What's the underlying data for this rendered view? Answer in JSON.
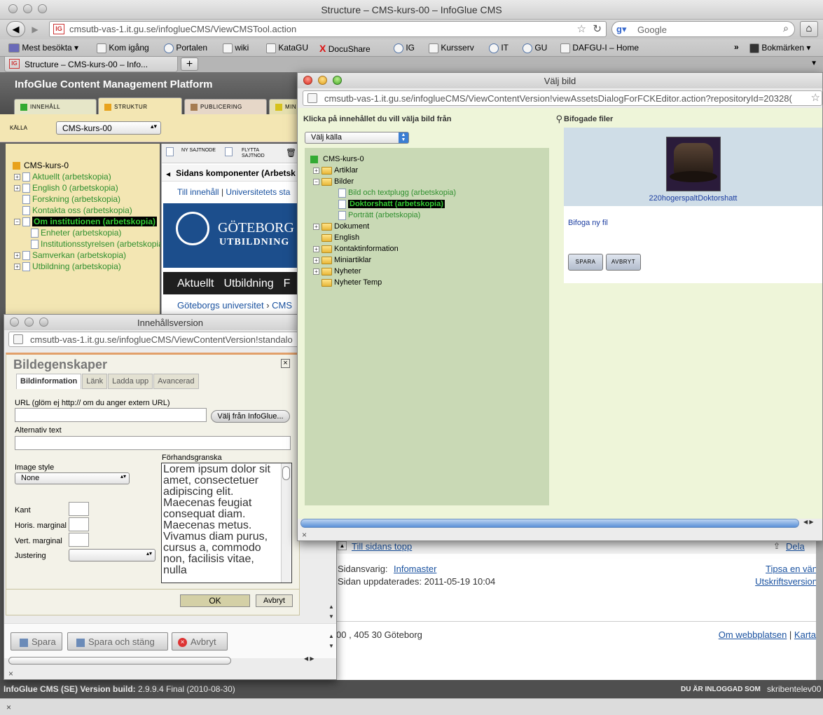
{
  "browser": {
    "window_title": "Structure – CMS-kurs-00 – InfoGlue CMS",
    "url": "cmsutb-vas-1.it.gu.se/infoglueCMS/ViewCMSTool.action",
    "search_placeholder": "Google",
    "bookmarks": [
      "Mest besökta",
      "Kom igång",
      "Portalen",
      "wiki",
      "KataGU",
      "DocuShare",
      "IG",
      "Kursserv",
      "IT",
      "GU",
      "DAFGU-I – Home"
    ],
    "bookmarks_menu": "Bokmärken",
    "tab_label": "Structure – CMS-kurs-00 – Info...",
    "new_tab": "+"
  },
  "cms": {
    "title": "InfoGlue Content Management Platform",
    "tabs": [
      "INNEHÅLL",
      "STRUKTUR",
      "PUBLICERING",
      "MIN"
    ],
    "source_label": "KÄLLA",
    "source_value": "CMS-kurs-00",
    "tree_root": "CMS-kurs-0",
    "tree_items": [
      "Aktuellt (arbetskopia)",
      "English 0 (arbetskopia)",
      "Forskning (arbetskopia)",
      "Kontakta oss (arbetskopia)",
      "Om institutionen (arbetskopia)",
      "Enheter (arbetskopia)",
      "Institutionsstyrelsen (arbetskopia)",
      "Samverkan (arbetskopia)",
      "Utbildning (arbetskopia)"
    ],
    "toolbar": {
      "new_node": "NY SAJTNODE",
      "move_node": "FLYTTA SAJTNOD"
    },
    "components_header": "Sidans komponenter (Arbetsk",
    "content_links": [
      "Till innehåll",
      "Universitetets sta"
    ],
    "banner_line1": "GÖTEBORG",
    "banner_line2": "UTBILDNING",
    "nav_items": [
      "Aktuellt",
      "Utbildning",
      "F"
    ],
    "breadcrumb": [
      "Göteborgs universitet",
      "CMS"
    ],
    "to_top": "Till sidans topp",
    "share": "Dela",
    "responsible_label": "Sidansvarig:",
    "responsible_link": "Infomaster",
    "tip_link": "Tipsa en vän",
    "updated": "Sidan uppdaterades: 2011-05-19 10:04",
    "print_link": "Utskriftsversion",
    "address": "00 , 405 30 Göteborg",
    "about_link": "Om webbplatsen",
    "map_link": "Karta",
    "footer_label": "InfoGlue CMS (SE) Version build:",
    "footer_version": "2.9.9.4 Final (2010-08-30)",
    "logged_in_label": "DU ÄR INLOGGAD SOM",
    "logged_in_user": "skribentelev00"
  },
  "content_version_window": {
    "title": "Innehållsversion",
    "url": "cmsutb-vas-1.it.gu.se/infoglueCMS/ViewContentVersion!standalo",
    "dialog_title": "Bildegenskaper",
    "tabs": [
      "Bildinformation",
      "Länk",
      "Ladda upp",
      "Avancerad"
    ],
    "url_label": "URL (glöm ej http:// om du anger extern URL)",
    "choose_button": "Välj från InfoGlue...",
    "alt_label": "Alternativ text",
    "image_style_label": "Image style",
    "image_style_value": "None",
    "preview_label": "Förhandsgranska",
    "preview_text": "Lorem ipsum dolor sit amet, consectetuer adipiscing elit. Maecenas feugiat consequat diam. Maecenas metus. Vivamus diam purus, cursus a, commodo non, facilisis vitae, nulla",
    "border_label": "Kant",
    "hmargin_label": "Horis. marginal",
    "vmargin_label": "Vert. marginal",
    "align_label": "Justering",
    "ok": "OK",
    "cancel": "Avbryt",
    "save": "Spara",
    "save_close": "Spara och stäng",
    "abort": "Avbryt"
  },
  "choose_image_window": {
    "title": "Välj bild",
    "url": "cmsutb-vas-1.it.gu.se/infoglueCMS/ViewContentVersion!viewAssetsDialogForFCKEditor.action?repositoryId=20328(",
    "left_header": "Klicka på innehållet du vill välja bild från",
    "source_select": "Välj källa",
    "tree_root": "CMS-kurs-0",
    "tree": [
      {
        "label": "Artiklar",
        "type": "folder",
        "expander": "+",
        "level": 1
      },
      {
        "label": "Bilder",
        "type": "folder",
        "expander": "−",
        "level": 1
      },
      {
        "label": "Bild och textplugg (arbetskopia)",
        "type": "doc",
        "level": 2
      },
      {
        "label": "Doktorshatt (arbetskopia)",
        "type": "doc",
        "level": 2,
        "selected": true
      },
      {
        "label": "Porträtt (arbetskopia)",
        "type": "doc",
        "level": 2
      },
      {
        "label": "Dokument",
        "type": "folder",
        "expander": "+",
        "level": 1
      },
      {
        "label": "English",
        "type": "folder",
        "level": 1
      },
      {
        "label": "Kontaktinformation",
        "type": "folder",
        "expander": "+",
        "level": 1
      },
      {
        "label": "Miniartiklar",
        "type": "folder",
        "expander": "+",
        "level": 1
      },
      {
        "label": "Nyheter",
        "type": "folder",
        "expander": "+",
        "level": 1
      },
      {
        "label": "Nyheter Temp",
        "type": "folder",
        "level": 1
      }
    ],
    "right_header": "Bifogade filer",
    "image_caption": "220hogerspaltDoktorshatt",
    "attach_link": "Bifoga ny fil",
    "save": "SPARA",
    "cancel": "AVBRYT"
  }
}
